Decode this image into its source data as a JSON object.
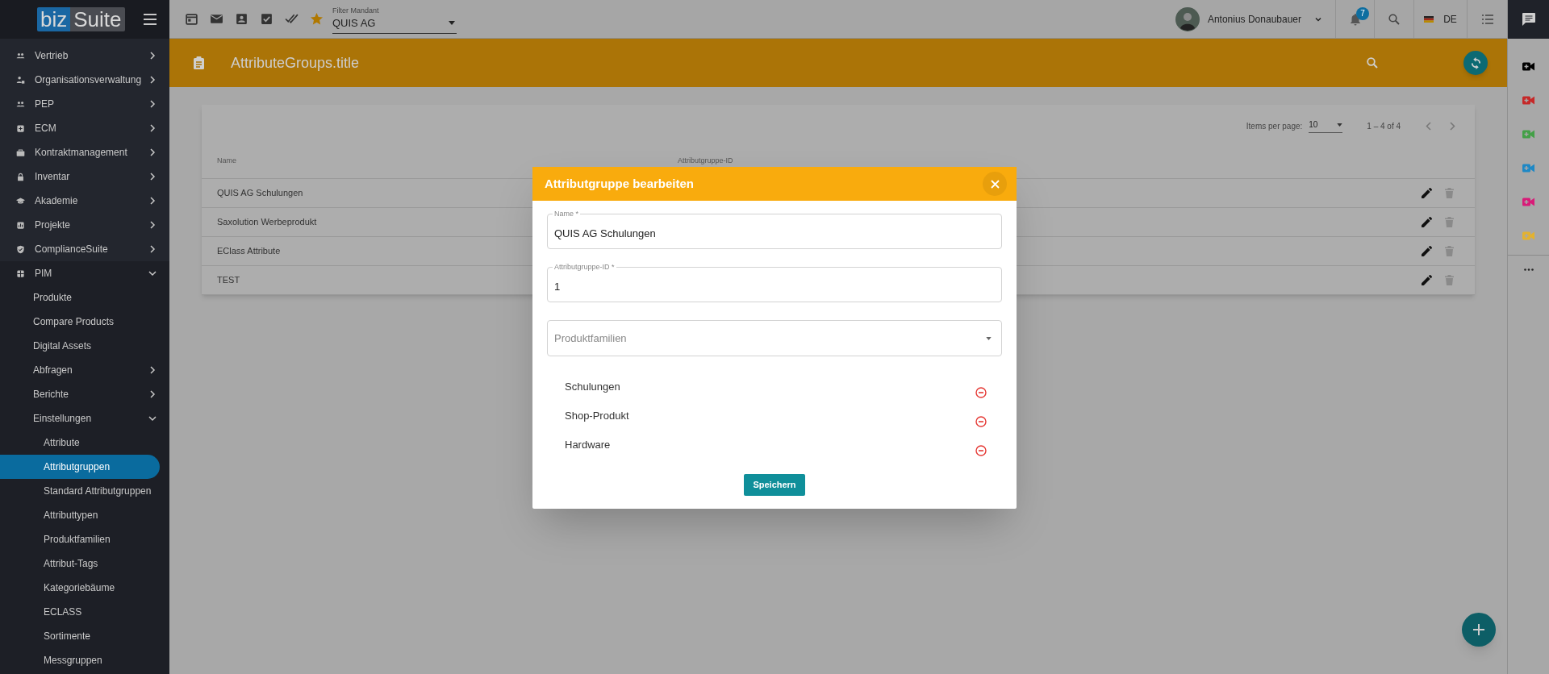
{
  "logo": {
    "part_1": "biz",
    "part_2": "Suite"
  },
  "sidebar": {
    "items": [
      {
        "label": "Vertrieb",
        "expanded": false
      },
      {
        "label": "Organisationsverwaltung",
        "expanded": false
      },
      {
        "label": "PEP",
        "expanded": false
      },
      {
        "label": "ECM",
        "expanded": false
      },
      {
        "label": "Kontraktmanagement",
        "expanded": false
      },
      {
        "label": "Inventar",
        "expanded": false
      },
      {
        "label": "Akademie",
        "expanded": false
      },
      {
        "label": "Projekte",
        "expanded": false
      },
      {
        "label": "ComplianceSuite",
        "expanded": false
      },
      {
        "label": "PIM",
        "expanded": true,
        "children": [
          {
            "label": "Produkte",
            "selected": false
          },
          {
            "label": "Compare Products",
            "selected": false
          },
          {
            "label": "Digital Assets",
            "selected": false
          },
          {
            "label": "Abfragen",
            "selected": false,
            "expanded": false
          },
          {
            "label": "Berichte",
            "selected": false,
            "expanded": false
          },
          {
            "label": "Einstellungen",
            "selected": false,
            "expanded": true,
            "children": [
              {
                "label": "Attribute",
                "selected": false
              },
              {
                "label": "Attributgruppen",
                "selected": true
              },
              {
                "label": "Standard Attributgruppen",
                "selected": false
              },
              {
                "label": "Attributtypen",
                "selected": false
              },
              {
                "label": "Produktfamilien",
                "selected": false
              },
              {
                "label": "Attribut-Tags",
                "selected": false
              },
              {
                "label": "Kategoriebäume",
                "selected": false
              },
              {
                "label": "ECLASS",
                "selected": false
              },
              {
                "label": "Sortimente",
                "selected": false
              },
              {
                "label": "Messgruppen",
                "selected": false
              }
            ]
          }
        ]
      }
    ]
  },
  "topbar": {
    "filter": {
      "label": "Filter Mandant",
      "value": "QUIS AG"
    },
    "user": "Antonius Donaubauer",
    "notifications": "7",
    "language": "DE"
  },
  "header": {
    "title": "AttributeGroups.title"
  },
  "table": {
    "items_per_page_label": "Items per page:",
    "items_per_page": "10",
    "range": "1 – 4 of 4",
    "columns": [
      "Name",
      "Attributgruppe-ID"
    ],
    "rows": [
      {
        "name": "QUIS AG Schulungen"
      },
      {
        "name": "Saxolution Werbeprodukt"
      },
      {
        "name": "EClass Attribute"
      },
      {
        "name": "TEST"
      }
    ]
  },
  "dialog": {
    "title": "Attributgruppe bearbeiten",
    "fields": [
      {
        "label": "Name *",
        "value": "QUIS AG Schulungen"
      },
      {
        "label": "Attributgruppe-ID *",
        "value": "1"
      }
    ],
    "select": {
      "placeholder": "Produktfamilien"
    },
    "families": [
      "Schulungen",
      "Shop-Produkt",
      "Hardware"
    ],
    "save": "Speichern"
  },
  "rail": {
    "cameras": [
      {
        "color": "#000000"
      },
      {
        "color": "#c62828"
      },
      {
        "color": "#43a047"
      },
      {
        "color": "#1e88c5"
      },
      {
        "color": "#d81b78"
      },
      {
        "color": "#e3b230"
      }
    ]
  }
}
